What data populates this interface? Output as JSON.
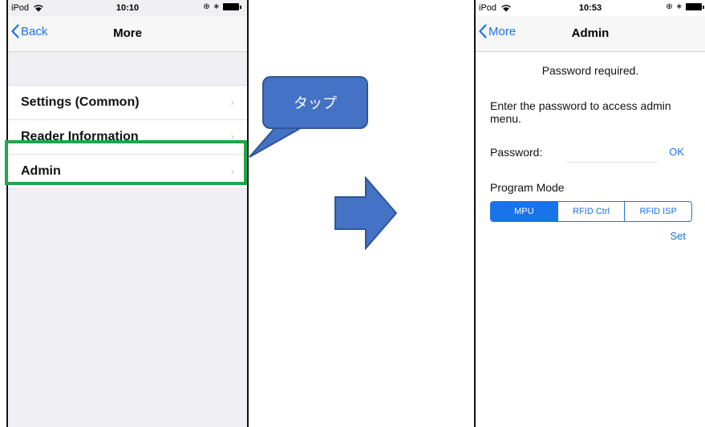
{
  "left_screen": {
    "status": {
      "carrier": "iPod",
      "time": "10:10"
    },
    "nav": {
      "back_label": "Back",
      "title": "More"
    },
    "items": [
      {
        "label": "Settings (Common)"
      },
      {
        "label": "Reader Information"
      },
      {
        "label": "Admin"
      }
    ]
  },
  "callout": {
    "text": "タップ"
  },
  "right_screen": {
    "status": {
      "carrier": "iPod",
      "time": "10:53"
    },
    "nav": {
      "back_label": "More",
      "title": "Admin"
    },
    "password_required": "Password required.",
    "instructions": "Enter the password to access admin menu.",
    "password_label": "Password:",
    "password_value": "",
    "ok_label": "OK",
    "program_mode_label": "Program Mode",
    "modes": [
      "MPU",
      "RFID Ctrl",
      "RFID ISP"
    ],
    "selected_mode": "MPU",
    "set_label": "Set"
  },
  "colors": {
    "ios_blue": "#1a73e8",
    "highlight_green": "#1fa64a",
    "callout_blue": "#4472c4"
  }
}
